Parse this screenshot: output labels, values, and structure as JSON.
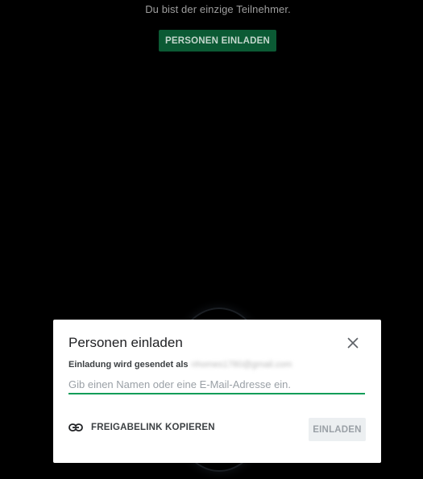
{
  "meeting": {
    "status_text": "Du bist der einzige Teilnehmer.",
    "invite_button_label": "PERSONEN EINLADEN"
  },
  "dialog": {
    "title": "Personen einladen",
    "close_icon": "close-icon",
    "sender_label": "Einladung wird gesendet als",
    "sender_email": "nhomes1780@gmail.com",
    "input": {
      "value": "",
      "placeholder": "Gib einen Namen oder eine E-Mail-Adresse ein."
    },
    "copy_link": {
      "icon": "link-icon",
      "label": "FREIGABELINK KOPIEREN"
    },
    "invite_label": "EINLADEN"
  },
  "colors": {
    "background": "#000000",
    "accent_green": "#0f9d58",
    "top_button_bg": "#0b5a34",
    "dialog_bg": "#ffffff",
    "disabled_button_bg": "#eceff1"
  }
}
